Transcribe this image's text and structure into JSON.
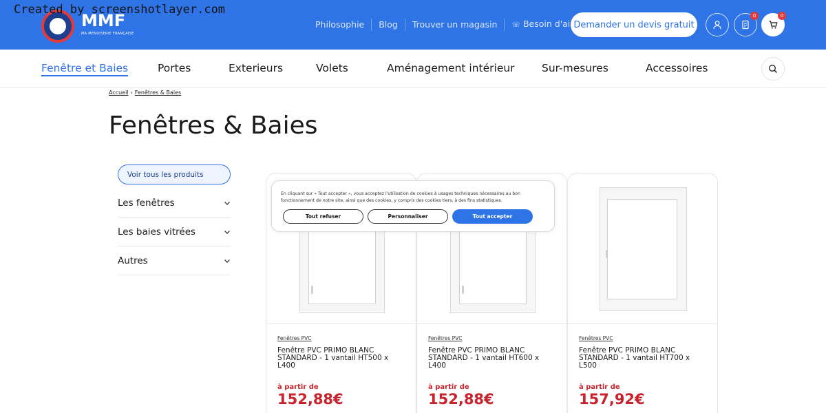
{
  "watermark": "Created by screenshotlayer.com",
  "brand": {
    "name": "MMF",
    "tagline": "MA MENUISERIE FRANÇAISE"
  },
  "colors": {
    "primary": "#2f74e6",
    "price": "#c8232c",
    "navy": "#1d3f8f"
  },
  "toplinks": [
    "Philosophie",
    "Blog",
    "Trouver un magasin",
    "Besoin d'aide ?"
  ],
  "header": {
    "cta_label": "Demander un devis gratuit",
    "account_icon": "user-icon",
    "quote_badge": "0",
    "cart_badge": "0"
  },
  "nav": [
    "Fenêtre et Baies",
    "Portes",
    "Exterieurs",
    "Volets",
    "Aménagement intérieur",
    "Sur-mesures",
    "Accessoires"
  ],
  "breadcrumb": {
    "home": "Accueil",
    "current": "Fenêtres & Baies"
  },
  "page_title": "Fenêtres & Baies",
  "sidebar": {
    "all_label": "Voir tous les produits",
    "categories": [
      "Les fenêtres",
      "Les baies vitrées",
      "Autres"
    ]
  },
  "products": [
    {
      "category": "Fenêtres PVC",
      "name": "Fenêtre PVC PRIMO BLANC STANDARD - 1 vantail HT500 x L400",
      "from": "à partir de",
      "price": "152,88€"
    },
    {
      "category": "Fenêtres PVC",
      "name": "Fenêtre PVC PRIMO BLANC STANDARD - 1 vantail HT600 x L400",
      "from": "à partir de",
      "price": "152,88€"
    },
    {
      "category": "Fenêtres PVC",
      "name": "Fenêtre PVC PRIMO BLANC STANDARD - 1 vantail HT700 x L500",
      "from": "à partir de",
      "price": "157,92€"
    }
  ],
  "cookie": {
    "text": "En cliquant sur « Tout accepter », vous acceptez l'utilisation de cookies à usages techniques nécessaires au bon fonctionnement de notre site, ainsi que des cookies, y compris des cookies tiers, à des fins statistiques.",
    "refuse": "Tout refuser",
    "customize": "Personnaliser",
    "accept": "Tout accepter"
  }
}
